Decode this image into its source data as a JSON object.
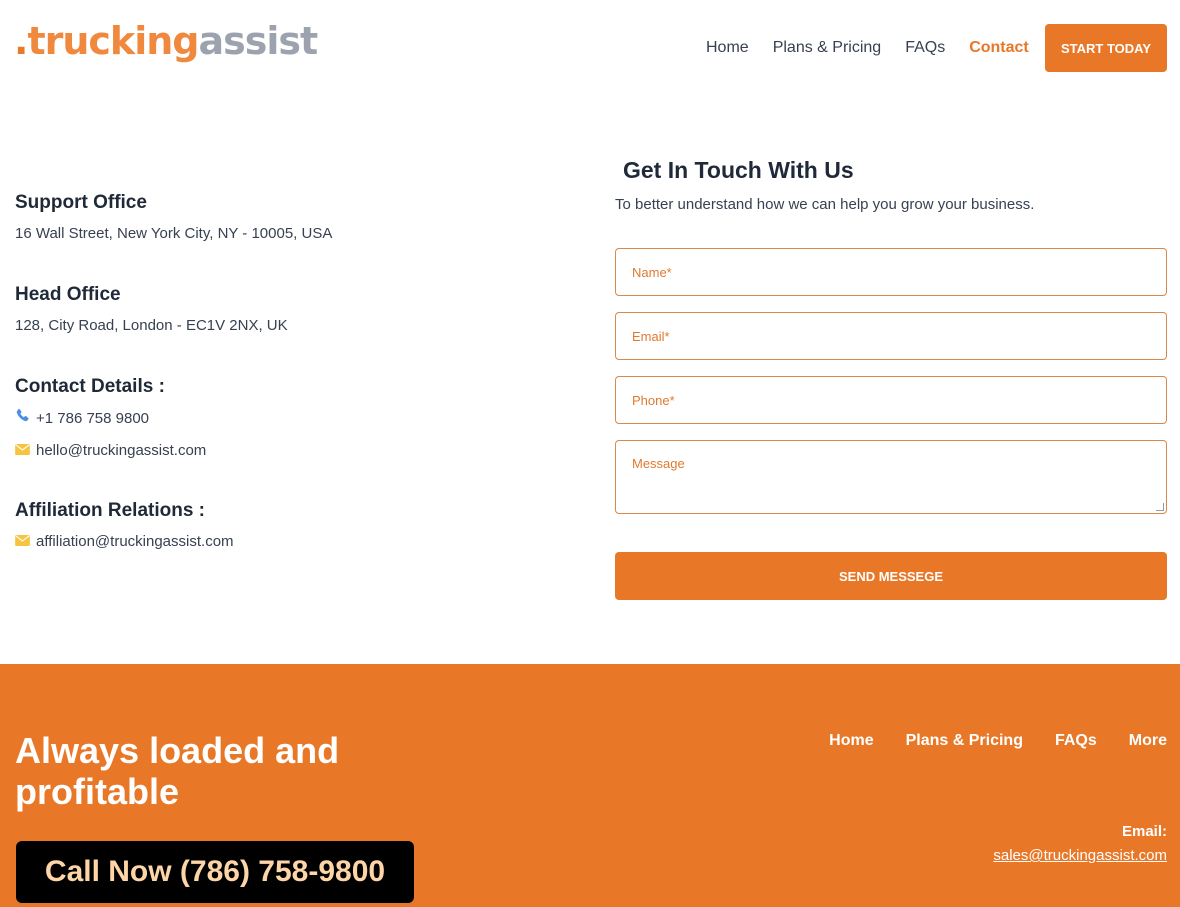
{
  "header": {
    "logo": {
      "dot": ".",
      "part1": "trucking",
      "part2": "assist"
    },
    "nav": [
      "Home",
      "Plans & Pricing",
      "FAQs",
      "Contact"
    ],
    "active_nav": "Contact",
    "cta_label": "START TODAY"
  },
  "info": {
    "support": {
      "title": "Support Office",
      "address": "16 Wall Street, New York City, NY - 10005, USA"
    },
    "head": {
      "title": "Head Office",
      "address": "128, City Road, London - EC1V 2NX, UK"
    },
    "contact": {
      "title": "Contact Details :",
      "phone": "+1 786 758 9800",
      "email": "hello@truckingassist.com"
    },
    "affiliation": {
      "title": "Affiliation Relations :",
      "email": "affiliation@truckingassist.com"
    }
  },
  "form": {
    "title": "Get In Touch With Us",
    "subtitle": "To better understand how we can help you grow your business.",
    "name_placeholder": "Name*",
    "email_placeholder": "Email*",
    "phone_placeholder": "Phone*",
    "message_placeholder": "Message",
    "submit_label": "SEND MESSEGE"
  },
  "footer": {
    "tagline": "Always loaded and profitable",
    "call_label": "Call Now (786) 758-9800",
    "nav": [
      "Home",
      "Plans & Pricing",
      "FAQs",
      "More"
    ],
    "email_label": "Email:",
    "email": "sales@truckingassist.com"
  },
  "colors": {
    "accent": "#e87827",
    "logo_gray": "#9ca3af",
    "phone_icon": "#4a90e2",
    "mail_icon": "#f5c542"
  },
  "icons": [
    "phone-icon",
    "mail-icon"
  ]
}
